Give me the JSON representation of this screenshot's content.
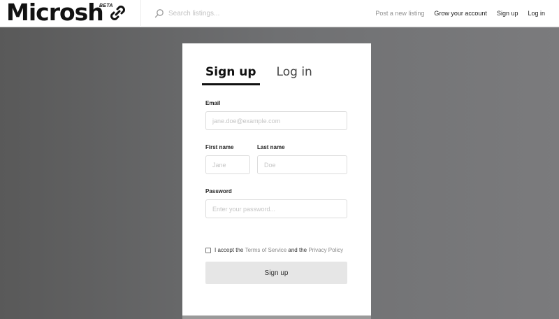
{
  "header": {
    "logo_text": "Microsh",
    "logo_badge": "BETA",
    "search_placeholder": "Search listings...",
    "nav": {
      "post_listing": "Post a new listing",
      "grow_account": "Grow your account",
      "sign_up": "Sign up",
      "log_in": "Log in"
    }
  },
  "form": {
    "tabs": {
      "sign_up": "Sign up",
      "log_in": "Log in"
    },
    "email_label": "Email",
    "email_placeholder": "jane.doe@example.com",
    "first_name_label": "First name",
    "first_name_placeholder": "Jane",
    "last_name_label": "Last name",
    "last_name_placeholder": "Doe",
    "password_label": "Password",
    "password_placeholder": "Enter your password...",
    "terms_prefix": "I accept the",
    "terms_of_service": "Terms of Service",
    "terms_and": "and the",
    "privacy_policy": "Privacy Policy",
    "submit_label": "Sign up"
  }
}
